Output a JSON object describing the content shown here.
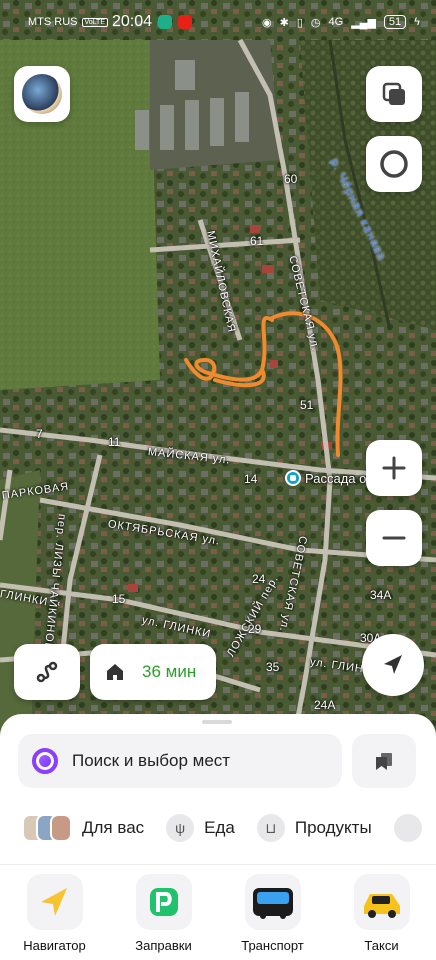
{
  "status_bar": {
    "carrier": "MTS RUS",
    "volte": "VoLTE",
    "time": "20:04",
    "network": "4G",
    "battery": "51"
  },
  "map": {
    "streets": [
      {
        "name": "МИХАЙЛОВСКАЯ"
      },
      {
        "name": "СОВЕТСКАЯ ул."
      },
      {
        "name": "МАЙСКАЯ ул."
      },
      {
        "name": "ОКТЯБРЬСКАЯ ул."
      },
      {
        "name": "ул. ГЛИНКИ"
      },
      {
        "name": "пер. ЛИЗЫ ЧАЙКИНОЙ"
      },
      {
        "name": "СОВЕТСКАЯ ул."
      },
      {
        "name": "ул. ГЛИНКИ"
      },
      {
        "name": "ПАРКОВАЯ"
      },
      {
        "name": "ГЛИНКИ"
      },
      {
        "name": "ЛОЖСКИЙ пер."
      }
    ],
    "river": "р. Чёрная канава",
    "house_numbers": [
      "60",
      "61",
      "51",
      "7",
      "11",
      "14",
      "24",
      "15",
      "29",
      "35",
      "34А",
      "30А",
      "24А"
    ],
    "poi_label": "Рассада овощей",
    "route_color": "#f08a2e"
  },
  "controls": {
    "route_time": "36 мин"
  },
  "sheet": {
    "search_placeholder": "Поиск и выбор мест",
    "chips": [
      {
        "label": "Для вас",
        "icon": "thumbnails"
      },
      {
        "label": "Еда",
        "icon": "fork-knife-icon"
      },
      {
        "label": "Продукты",
        "icon": "basket-icon"
      }
    ],
    "apps": [
      {
        "label": "Навигатор",
        "icon": "navigator-arrow-icon"
      },
      {
        "label": "Заправки",
        "icon": "fuel-icon"
      },
      {
        "label": "Транспорт",
        "icon": "bus-icon"
      },
      {
        "label": "Такси",
        "icon": "taxi-icon"
      }
    ]
  }
}
